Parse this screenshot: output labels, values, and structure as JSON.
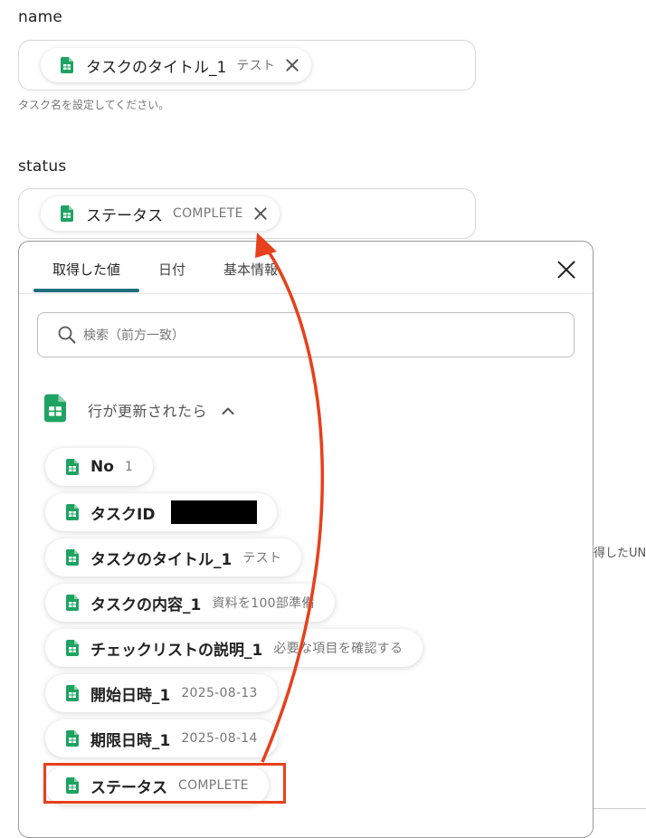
{
  "name_field": {
    "label": "name",
    "chip": {
      "main": "タスクのタイトル_1",
      "sub": "テスト"
    },
    "hint": "タスク名を設定してください。"
  },
  "status_field": {
    "label": "status",
    "chip": {
      "main": "ステータス",
      "sub": "COMPLETE"
    }
  },
  "popup": {
    "tabs": [
      "取得した値",
      "日付",
      "基本情報"
    ],
    "active_tab": "取得した値",
    "search_placeholder": "検索（前方一致）",
    "group_title": "行が更新されたら",
    "items": [
      {
        "name": "No",
        "value": "1"
      },
      {
        "name": "タスクID",
        "value": ""
      },
      {
        "name": "タスクのタイトル_1",
        "value": "テスト"
      },
      {
        "name": "タスクの内容_1",
        "value": "資料を100部準備"
      },
      {
        "name": "チェックリストの説明_1",
        "value": "必要な項目を確認する"
      },
      {
        "name": "開始日時_1",
        "value": "2025-08-13"
      },
      {
        "name": "期限日時_1",
        "value": "2025-08-14"
      },
      {
        "name": "ステータス",
        "value": "COMPLETE"
      }
    ]
  },
  "background_text": "得したUN",
  "colors": {
    "accent_tab": "#1f6e7e",
    "highlight_red": "#e8401c",
    "sheets_green": "#1ea362"
  },
  "icons": {
    "sheet": "google-sheets-icon",
    "close": "close-icon",
    "search": "search-icon",
    "caret": "chevron-up-icon"
  }
}
